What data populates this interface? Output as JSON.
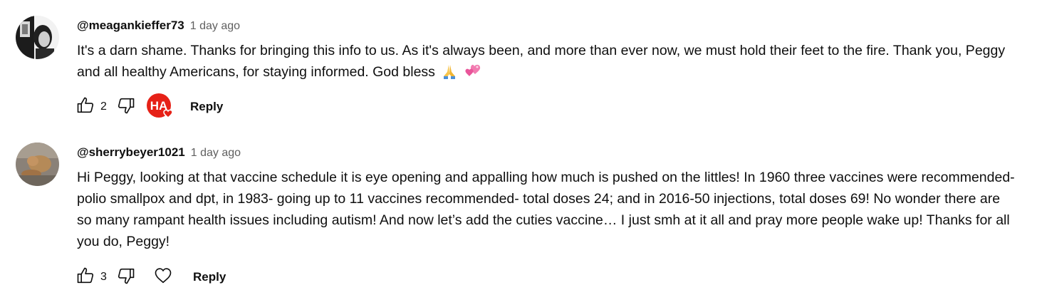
{
  "comments": [
    {
      "author": "@meagankieffer73",
      "timestamp": "1 day ago",
      "text": "It's a darn shame. Thanks for bringing this info to us. As it's always been, and more than ever now, we must hold their feet to the fire. Thank you, Peggy and all healthy Americans, for staying informed. God bless",
      "emojis": [
        "folded-hands",
        "two-hearts"
      ],
      "likes": "2",
      "creator_heart": true,
      "creator_badge_text": "HA",
      "reply_label": "Reply"
    },
    {
      "author": "@sherrybeyer1021",
      "timestamp": "1 day ago",
      "text": "Hi Peggy, looking at that vaccine schedule it is eye opening and appalling  how much is pushed on the littles! In 1960 three vaccines were recommended-polio smallpox and dpt, in 1983- going up to 11 vaccines recommended- total doses 24; and in 2016-50 injections, total doses 69! No wonder there are so many rampant health issues including autism! And now let’s add the cuties vaccine… I just smh at it all and pray more people wake up! Thanks for all you do, Peggy!",
      "likes": "3",
      "creator_heart": false,
      "reply_label": "Reply"
    }
  ],
  "colors": {
    "text": "#0f0f0f",
    "secondary": "#606060",
    "badge_red": "#e62117"
  }
}
